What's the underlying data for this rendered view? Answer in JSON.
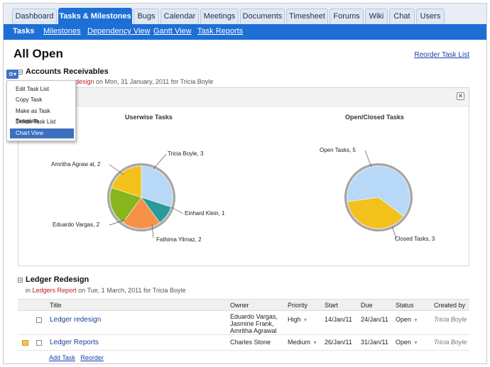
{
  "tabs": [
    "Dashboard",
    "Tasks & Milestones",
    "Bugs",
    "Calendar",
    "Meetings",
    "Documents",
    "Timesheet",
    "Forums",
    "Wiki",
    "Chat",
    "Users"
  ],
  "subnav": [
    "Tasks",
    "Milestones",
    "Dependency View",
    "Gantt View",
    "Task Reports"
  ],
  "page": {
    "title": "All Open",
    "reorder_task_list": "Reorder Task List"
  },
  "tasklist1": {
    "name": "Accounts Receivables",
    "meta_in": "in",
    "meta_project": "Ledger Redesign",
    "meta_project_visible": "design",
    "meta_rest": "on Mon, 31 January, 2011 for Tricia Boyle"
  },
  "gear": {
    "icon": "gear-icon",
    "menu": [
      "Edit Task List",
      "Copy Task",
      "Make as Task Template",
      "Delete Task List",
      "Chart View"
    ],
    "active_index": 4
  },
  "chart_panel": {
    "close_icon": "close-icon"
  },
  "chart_data": [
    {
      "type": "pie",
      "title": "Userwise Tasks",
      "categories": [
        "Tricia Boyle",
        "Einhard Klein",
        "Fathima Yilmaz",
        "Eduardo Vargas",
        "Amritha Agrawal"
      ],
      "values": [
        3,
        1,
        2,
        2,
        2
      ],
      "colors": [
        "#b7d9f7",
        "#2a9a9a",
        "#f7914a",
        "#86b61c",
        "#f3c11c"
      ],
      "labels": [
        "Tricia Boyle, 3",
        "Einhard Klein, 1",
        "Fathima Yilmaz, 2",
        "Eduardo Vargas, 2",
        "Amritha Agraw al, 2"
      ]
    },
    {
      "type": "pie",
      "title": "Open/Closed Tasks",
      "categories": [
        "Open Tasks",
        "Closed Tasks"
      ],
      "values": [
        5,
        3
      ],
      "colors": [
        "#b7d9f7",
        "#f3c11c"
      ],
      "labels": [
        "Open Tasks, 5",
        "Closed Tasks, 3"
      ]
    }
  ],
  "tasklist2": {
    "name": "Ledger Redesign",
    "meta_in": "in",
    "meta_project": "Ledgers Report",
    "meta_rest": "on Tue, 1 March, 2011 for Tricia Boyle"
  },
  "table": {
    "headers": [
      "Title",
      "Owner",
      "Priority",
      "Start",
      "Due",
      "Status",
      "Created by"
    ],
    "rows": [
      {
        "title": "Ledger redesign",
        "owner_lines": [
          "Eduardo Vargas,",
          "Jasmine Frank,",
          "Amritha Agrawal"
        ],
        "priority": "High",
        "start": "14/Jan/11",
        "due": "24/Jan/11",
        "status": "Open",
        "created_by": "Tricia Boyle"
      },
      {
        "title": "Ledger Reports",
        "owner_lines": [
          "Charles Stone"
        ],
        "priority": "Medium",
        "start": "26/Jan/11",
        "due": "31/Jan/11",
        "status": "Open",
        "created_by": "Tricia Boyle"
      }
    ],
    "add_task": "Add Task",
    "reorder": "Reorder"
  }
}
